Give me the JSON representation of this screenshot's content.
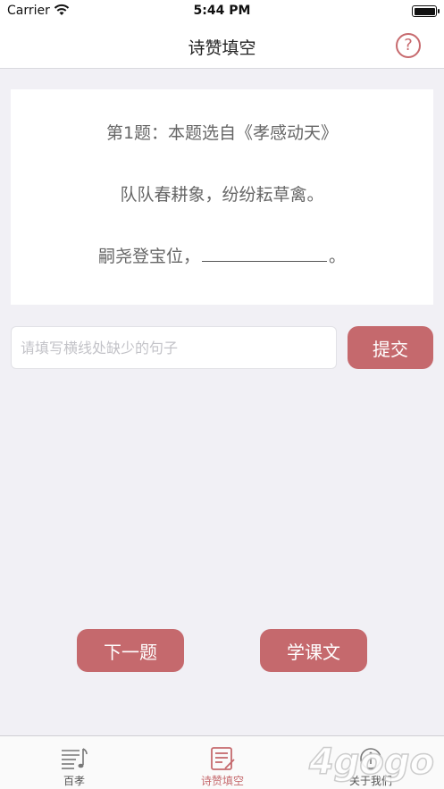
{
  "status_bar": {
    "carrier": "Carrier",
    "time": "5:44 PM"
  },
  "nav": {
    "title": "诗赞填空",
    "help_symbol": "?"
  },
  "question": {
    "title": "第1题：本题选自《孝感动天》",
    "line1": "队队春耕象，纷纷耘草禽。",
    "line2_prefix": "嗣尧登宝位，",
    "line2_suffix": "。"
  },
  "answer": {
    "placeholder": "请填写横线处缺少的句子",
    "value": ""
  },
  "buttons": {
    "submit": "提交",
    "next": "下一题",
    "learn": "学课文"
  },
  "tabs": [
    {
      "label": "百孝",
      "icon": "music-list-icon",
      "active": false
    },
    {
      "label": "诗赞填空",
      "icon": "edit-note-icon",
      "active": true
    },
    {
      "label": "关于我们",
      "icon": "info-icon",
      "active": false
    }
  ],
  "watermark": {
    "text": "4gogo"
  },
  "colors": {
    "accent": "#c5696d",
    "background": "#f1f0f5",
    "card": "#ffffff"
  }
}
